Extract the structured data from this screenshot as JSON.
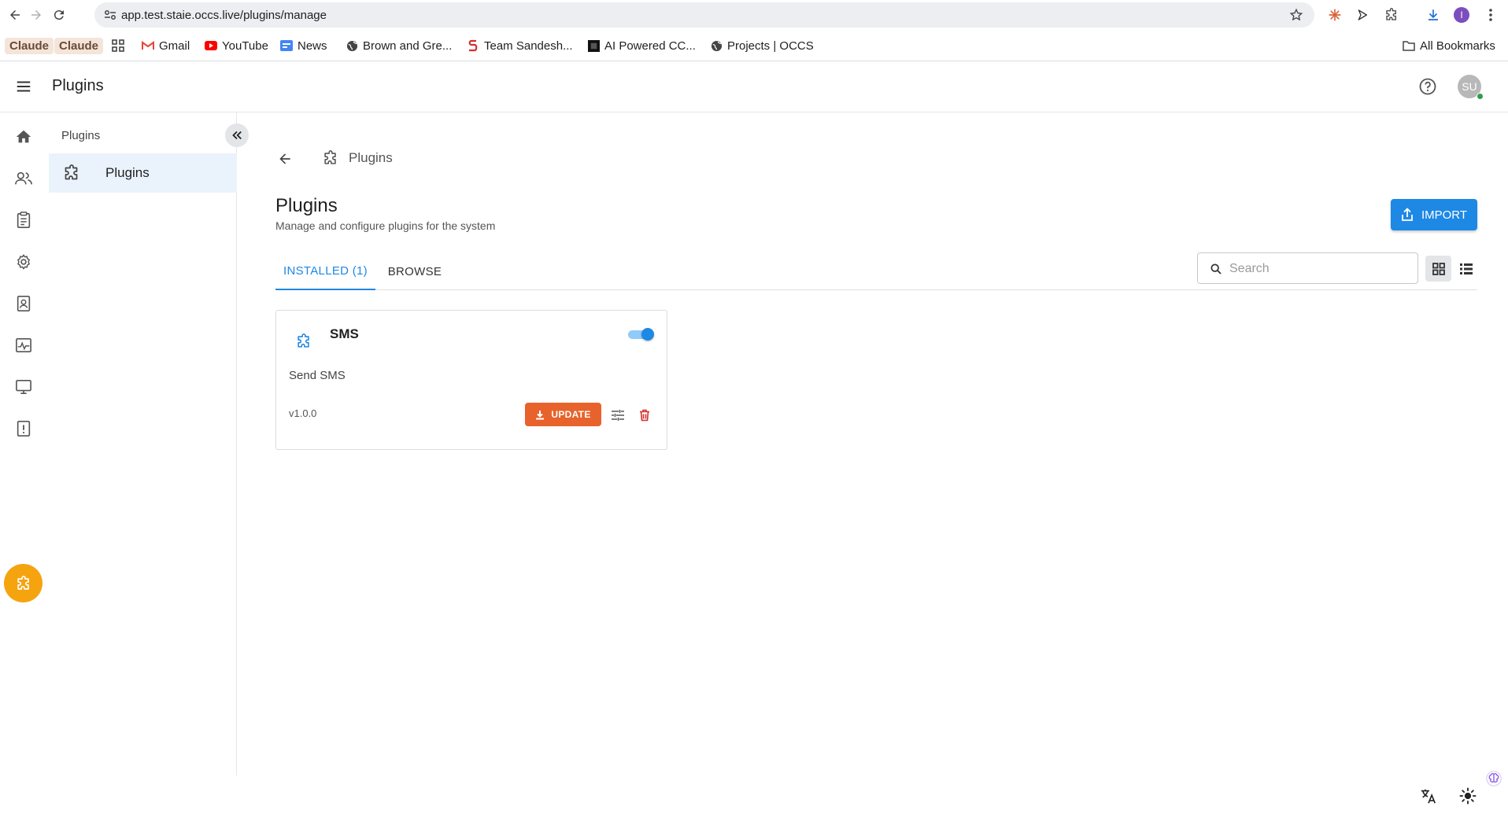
{
  "browser": {
    "url": "app.test.staie.occs.live/plugins/manage",
    "profile_initial": "I",
    "bookmarks": [
      {
        "label": "Claude",
        "style": "chip"
      },
      {
        "label": "Claude",
        "style": "chip"
      },
      {
        "label": "Gmail",
        "icon": "gmail-icon"
      },
      {
        "label": "YouTube",
        "icon": "youtube-icon"
      },
      {
        "label": "News",
        "icon": "news-icon"
      },
      {
        "label": "Brown and Gre...",
        "icon": "globe-icon"
      },
      {
        "label": "Team Sandesh...",
        "icon": "sandesh-icon"
      },
      {
        "label": "AI Powered CC...",
        "icon": "ai-icon"
      },
      {
        "label": "Projects | OCCS",
        "icon": "globe-icon"
      }
    ],
    "all_bookmarks_label": "All Bookmarks"
  },
  "header": {
    "title": "Plugins",
    "avatar_initials": "SU"
  },
  "subnav": {
    "heading": "Plugins",
    "items": [
      {
        "label": "Plugins",
        "active": true
      }
    ]
  },
  "breadcrumb": {
    "label": "Plugins"
  },
  "page": {
    "title": "Plugins",
    "subtitle": "Manage and configure plugins for the system",
    "import_label": "IMPORT"
  },
  "tabs": [
    {
      "label": "INSTALLED (1)",
      "active": true
    },
    {
      "label": "BROWSE",
      "active": false
    }
  ],
  "search": {
    "placeholder": "Search",
    "value": ""
  },
  "plugins": [
    {
      "name": "SMS",
      "description": "Send SMS",
      "version": "v1.0.0",
      "enabled": true,
      "update_label": "UPDATE"
    }
  ],
  "colors": {
    "primary": "#1e88e5",
    "update_button": "#e8622b",
    "active_rail": "#f5a30f",
    "delete": "#d32f2f"
  }
}
